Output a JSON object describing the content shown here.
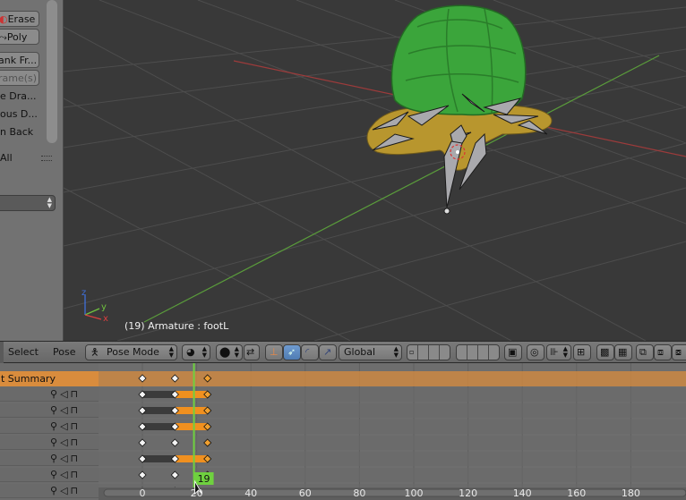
{
  "tool_shelf": {
    "buttons": [
      {
        "label": "Erase",
        "icon": "erase-icon"
      },
      {
        "label": "Poly",
        "icon": "poly-icon"
      },
      {
        "label": "ank Fr...",
        "disabled": false
      },
      {
        "label": "rame(s)",
        "disabled": true
      }
    ],
    "items": [
      "e Dra...",
      "ous D...",
      "n Back"
    ],
    "section_label": "All"
  },
  "viewport": {
    "object_label": "(19) Armature : footL",
    "axes": {
      "x": "x",
      "y": "y",
      "z": "z"
    },
    "colors": {
      "background": "#393939",
      "grid": "#4d4d4d",
      "x_axis": "#9c3b3b",
      "y_axis": "#5a9c3b",
      "shell": "#3ba53b",
      "body": "#b8962e"
    }
  },
  "header3d": {
    "menu": [
      "Select",
      "Pose"
    ],
    "mode": "Pose Mode",
    "orientation": "Global",
    "icons": [
      "pose-mode-icon",
      "viewport-shading-icon",
      "pivot-point-icon",
      "manipulator-icon",
      "translate-icon",
      "rotate-icon",
      "scale-icon",
      "layers-icon",
      "lock-icon",
      "proportional-icon",
      "snap-icon",
      "copy-pose-icon",
      "paste-pose-icon",
      "render-icon"
    ]
  },
  "timeline": {
    "summary_label": "t Summary",
    "current_frame": "19",
    "frame_ticks": [
      "0",
      "20",
      "40",
      "60",
      "80",
      "100",
      "120",
      "140",
      "160",
      "180"
    ],
    "row_icons": [
      "wrench-icon",
      "speaker-icon",
      "lock-icon"
    ],
    "keyframe_frames": [
      0,
      12,
      24
    ],
    "channels": 8,
    "colors": {
      "summary": "#d98c3d",
      "hold": "#3b3b3b",
      "selected_hold": "#f0901f",
      "playhead": "#6fd13f"
    }
  }
}
